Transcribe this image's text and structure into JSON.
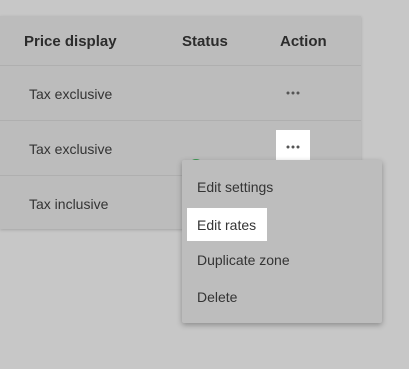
{
  "table": {
    "headers": {
      "price_display": "Price display",
      "status": "Status",
      "action": "Action"
    },
    "rows": [
      {
        "price_display": "Tax exclusive",
        "status": "",
        "action_icon": "more-horizontal-icon"
      },
      {
        "price_display": "Tax exclusive",
        "status": "active",
        "status_icon": "check-circle-icon",
        "action_icon": "more-horizontal-icon"
      },
      {
        "price_display": "Tax inclusive",
        "status": "",
        "action_icon": "more-horizontal-icon"
      }
    ]
  },
  "action_menu": {
    "items": [
      {
        "label": "Edit settings"
      },
      {
        "label": "Edit rates"
      },
      {
        "label": "Duplicate zone"
      },
      {
        "label": "Delete"
      }
    ],
    "highlighted_item": "Edit rates"
  },
  "colors": {
    "overlay_background": "#c7c7c7",
    "status_success": "#3f9a55"
  }
}
